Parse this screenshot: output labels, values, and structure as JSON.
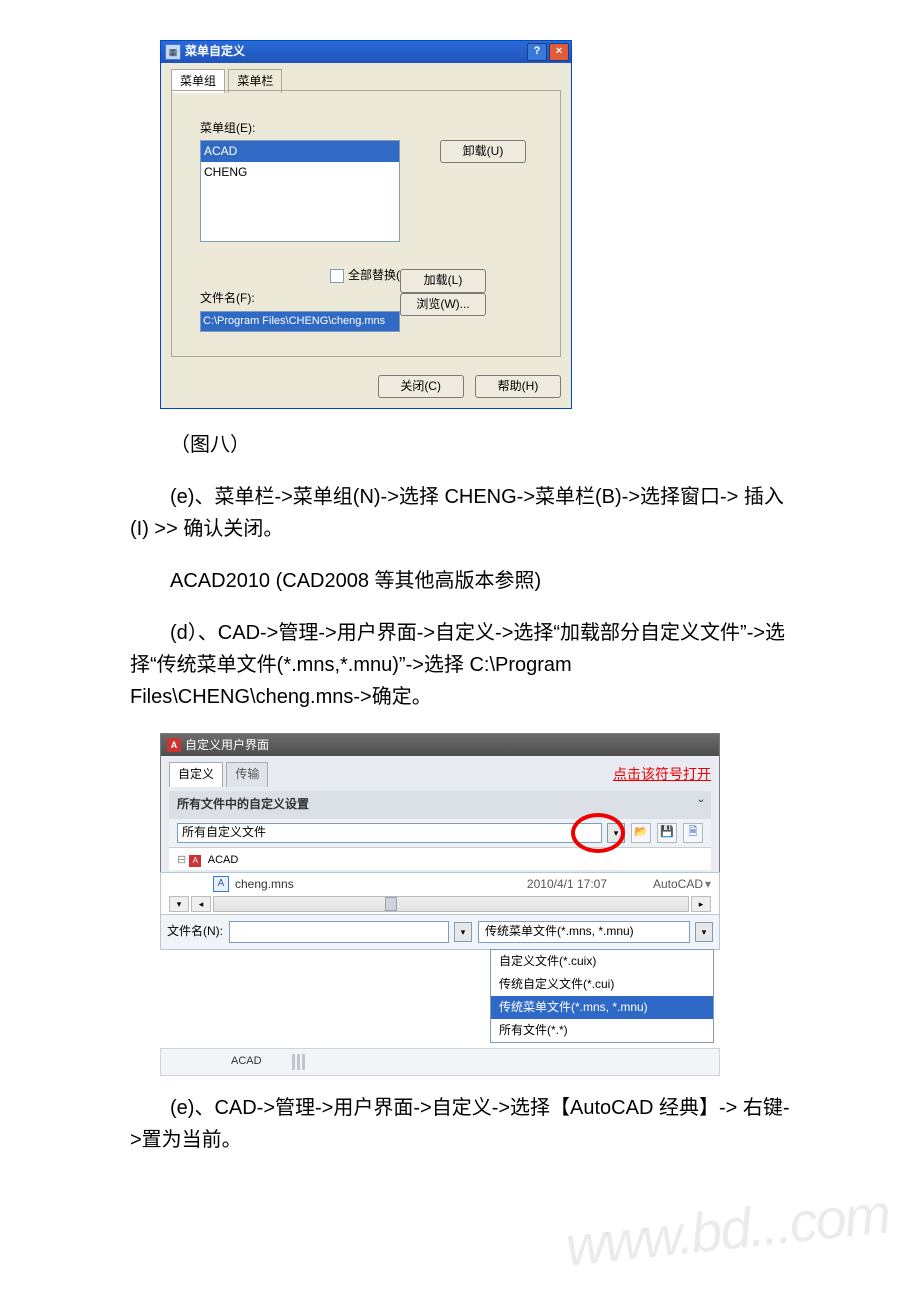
{
  "dlg1": {
    "title": "菜单自定义",
    "tab_group": "菜单组",
    "tab_bar": "菜单栏",
    "menu_group_label": "菜单组(E):",
    "items": [
      "ACAD",
      "CHENG"
    ],
    "btn_unload": "卸载(U)",
    "chk_replace": "全部替换(R)",
    "btn_load": "加载(L)",
    "file_label": "文件名(F):",
    "file_value": "C:\\Program Files\\CHENG\\cheng.mns",
    "btn_browse": "浏览(W)...",
    "btn_close": "关闭(C)",
    "btn_help": "帮助(H)"
  },
  "text": {
    "fig8": "（图八）",
    "para_e1": "(e)、菜单栏->菜单组(N)->选择 CHENG->菜单栏(B)->选择窗口-> 插入(I) >> 确认关闭。",
    "para_acad": "ACAD2010 (CAD2008 等其他高版本参照)",
    "para_d": "(d）、CAD->管理->用户界面->自定义->选择“加载部分自定义文件”->选择“传统菜单文件(*.mns,*.mnu)”->选择 C:\\Program Files\\CHENG\\cheng.mns->确定。",
    "para_e2": "(e)、CAD->管理->用户界面->自定义->选择【AutoCAD 经典】-> 右键->置为当前。"
  },
  "cui": {
    "title": "自定义用户界面",
    "tab_custom": "自定义",
    "tab_transfer": "传输",
    "click_hint": "点击该符号打开",
    "group_head": "所有文件中的自定义设置",
    "dropdown_value": "所有自定义文件",
    "tree_item": "ACAD"
  },
  "file": {
    "name": "cheng.mns",
    "date": "2010/4/1 17:07",
    "type": "AutoCAD",
    "fn_label": "文件名(N):"
  },
  "filter": {
    "selected": "传统菜单文件(*.mns, *.mnu)",
    "options": [
      "自定义文件(*.cuix)",
      "传统自定义文件(*.cui)",
      "传统菜单文件(*.mns, *.mnu)",
      "所有文件(*.*)"
    ]
  },
  "tree_bottom": "ACAD",
  "watermark": "www.bd...com"
}
